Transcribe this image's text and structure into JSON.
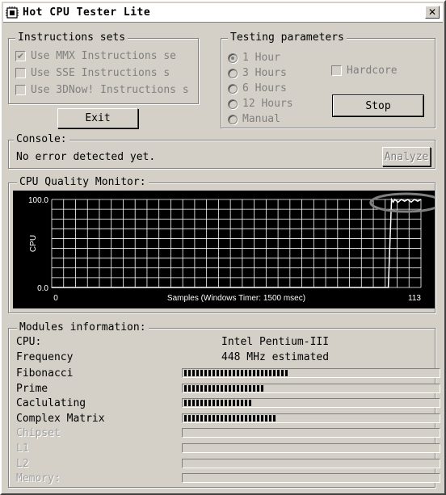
{
  "window": {
    "title": "Hot CPU Tester Lite",
    "close_glyph": "✕"
  },
  "instructions": {
    "legend": "Instructions sets",
    "items": [
      {
        "label": "Use MMX Instructions se",
        "checked": true
      },
      {
        "label": "Use SSE Instructions s",
        "checked": false
      },
      {
        "label": "Use 3DNow! Instructions s",
        "checked": false
      }
    ],
    "exit_label": "Exit"
  },
  "testing": {
    "legend": "Testing parameters",
    "options": [
      {
        "label": "1 Hour",
        "selected": true
      },
      {
        "label": "3 Hours",
        "selected": false
      },
      {
        "label": "6 Hours",
        "selected": false
      },
      {
        "label": "12 Hours",
        "selected": false
      },
      {
        "label": "Manual",
        "selected": false
      }
    ],
    "hardcore_label": "Hardcore",
    "stop_label": "Stop"
  },
  "console": {
    "legend": "Console:",
    "message": "No error detected yet.",
    "analyze_label": "Analyze"
  },
  "monitor": {
    "legend": "CPU Quality Monitor:",
    "chart_data": {
      "type": "line",
      "title": "",
      "xlabel": "Samples (Windows Timer: 1500 msec)",
      "ylabel": "CPU",
      "xlim": [
        0,
        113
      ],
      "ylim": [
        0,
        100
      ],
      "x_tick_labels": [
        "0",
        "113"
      ],
      "y_tick_labels": [
        "100.0",
        "0.0"
      ],
      "grid": true,
      "series": [
        {
          "x": [
            0,
            103,
            104,
            104.5,
            105,
            106,
            107,
            108,
            109,
            110,
            111,
            112,
            113
          ],
          "y": [
            0,
            0,
            100,
            97,
            100,
            97,
            100,
            98,
            100,
            97,
            100,
            98,
            100
          ]
        }
      ],
      "colors": {
        "background": "#000000",
        "grid": "#ffffff",
        "line": "#ffffff",
        "highlight_ellipse": "#808080"
      }
    }
  },
  "modules": {
    "legend": "Modules information:",
    "cpu_label": "CPU:",
    "cpu_value": "Intel Pentium-III",
    "freq_label": "Frequency",
    "freq_value": "448 MHz estimated",
    "bars": [
      {
        "label": "Fibonacci",
        "value": 0.41,
        "enabled": true
      },
      {
        "label": "Prime",
        "value": 0.32,
        "enabled": true
      },
      {
        "label": "Caclulating",
        "value": 0.27,
        "enabled": true
      },
      {
        "label": "Complex Matrix",
        "value": 0.36,
        "enabled": true
      },
      {
        "label": "Chipset",
        "value": 0,
        "enabled": false
      },
      {
        "label": "L1",
        "value": 0,
        "enabled": false
      },
      {
        "label": "L2",
        "value": 0,
        "enabled": false
      },
      {
        "label": "Memory:",
        "value": 0,
        "enabled": false
      }
    ]
  }
}
